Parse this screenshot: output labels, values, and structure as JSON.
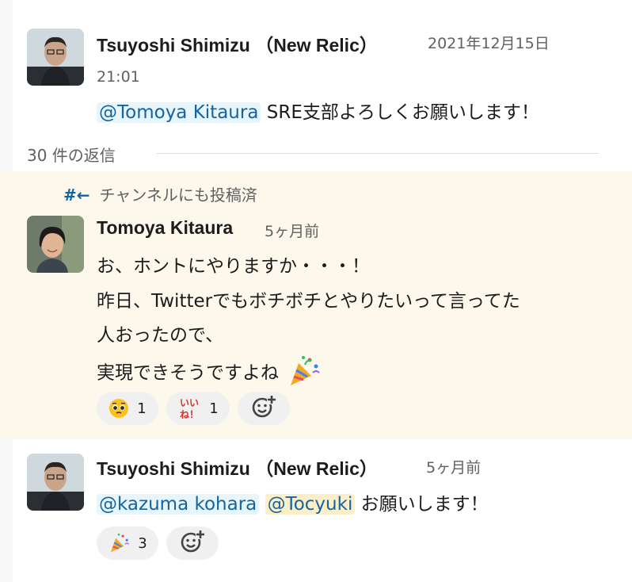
{
  "messages": [
    {
      "author": "Tsuyoshi Shimizu （New Relic）",
      "date": "2021年12月15日",
      "time": "21:01",
      "mention": "@Tomoya Kitaura",
      "body": "SRE支部よろしくお願いします！"
    },
    {
      "author": "Tomoya Kitaura",
      "timestamp": "5ヶ月前",
      "lines": [
        "お、ホントにやりますか・・・！",
        "昨日、Twitterでもボチボチとやりたいって言ってた",
        "人おったので、",
        "実現できそうですよね"
      ],
      "reactions": [
        {
          "icon": "pleading-face-icon",
          "count": "1"
        },
        {
          "icon": "iine-icon",
          "count": "1",
          "icon_text": "いい\nね！"
        }
      ]
    },
    {
      "author": "Tsuyoshi Shimizu （New Relic）",
      "timestamp": "5ヶ月前",
      "mentions": [
        "@kazuma kohara",
        "@Tocyuki"
      ],
      "body": "お願いします！",
      "reactions": [
        {
          "icon": "party-popper-icon",
          "count": "3"
        }
      ]
    }
  ],
  "thread": {
    "reply_count": "30 件の返信",
    "also_sent_label": "チャンネルにも投稿済",
    "also_sent_icon": "#←"
  },
  "colors": {
    "mention_bg": "#e8f5fa",
    "mention_text": "#1264a3",
    "self_mention_bg": "#fcefc7",
    "highlight_bg": "#fdf8ec"
  }
}
